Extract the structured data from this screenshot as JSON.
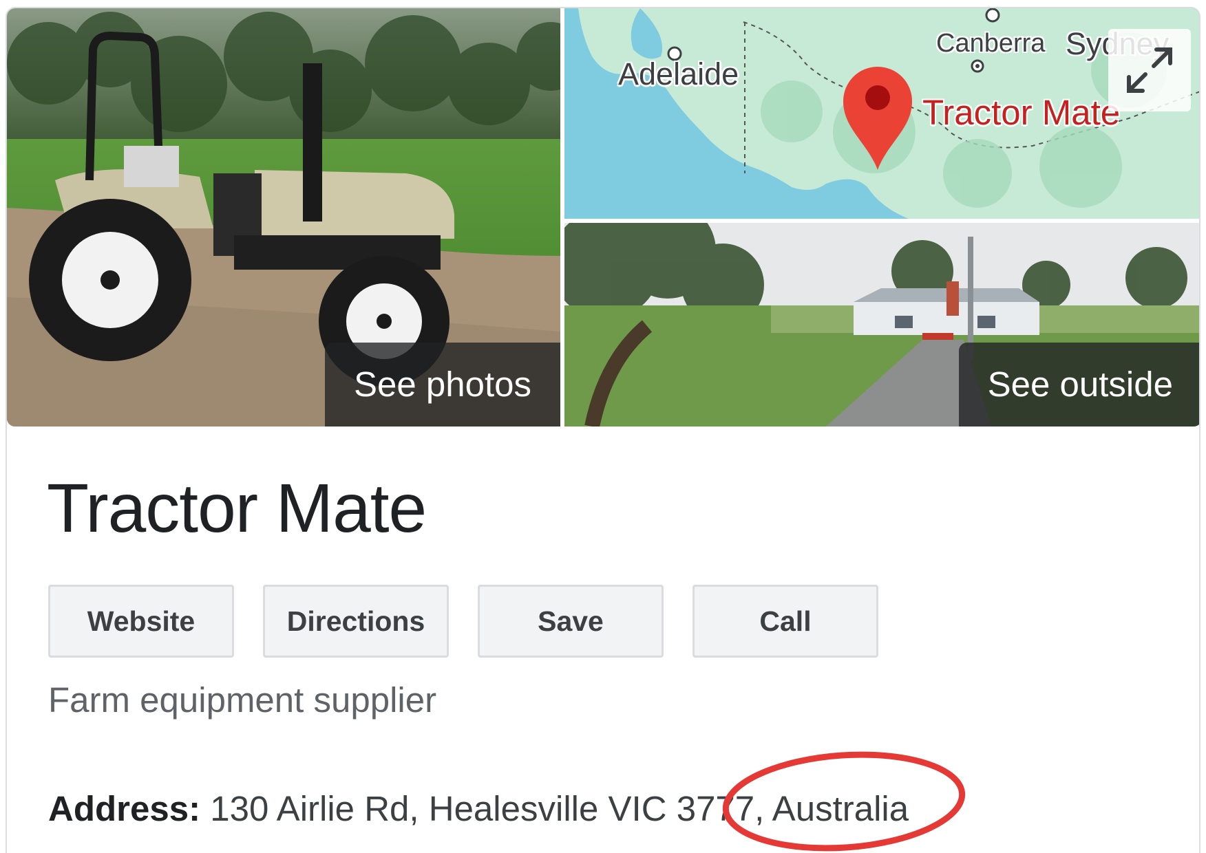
{
  "gallery": {
    "photos_label": "See photos",
    "outside_label": "See outside"
  },
  "map": {
    "cities": {
      "adelaide": "Adelaide",
      "canberra": "Canberra",
      "sydney": "Sydney"
    },
    "place_label": "Tractor Mate",
    "marker_color": "#ea4335",
    "water_color": "#7fcbe0",
    "land_color": "#c6ead6"
  },
  "business": {
    "title": "Tractor Mate",
    "category": "Farm equipment supplier",
    "address_label": "Address:",
    "address_value": "130 Airlie Rd, Healesville VIC 3777, Australia"
  },
  "actions": {
    "website": "Website",
    "directions": "Directions",
    "save": "Save",
    "call": "Call"
  },
  "annotation": {
    "color": "#e53935",
    "shape": "ellipse around Australia"
  }
}
